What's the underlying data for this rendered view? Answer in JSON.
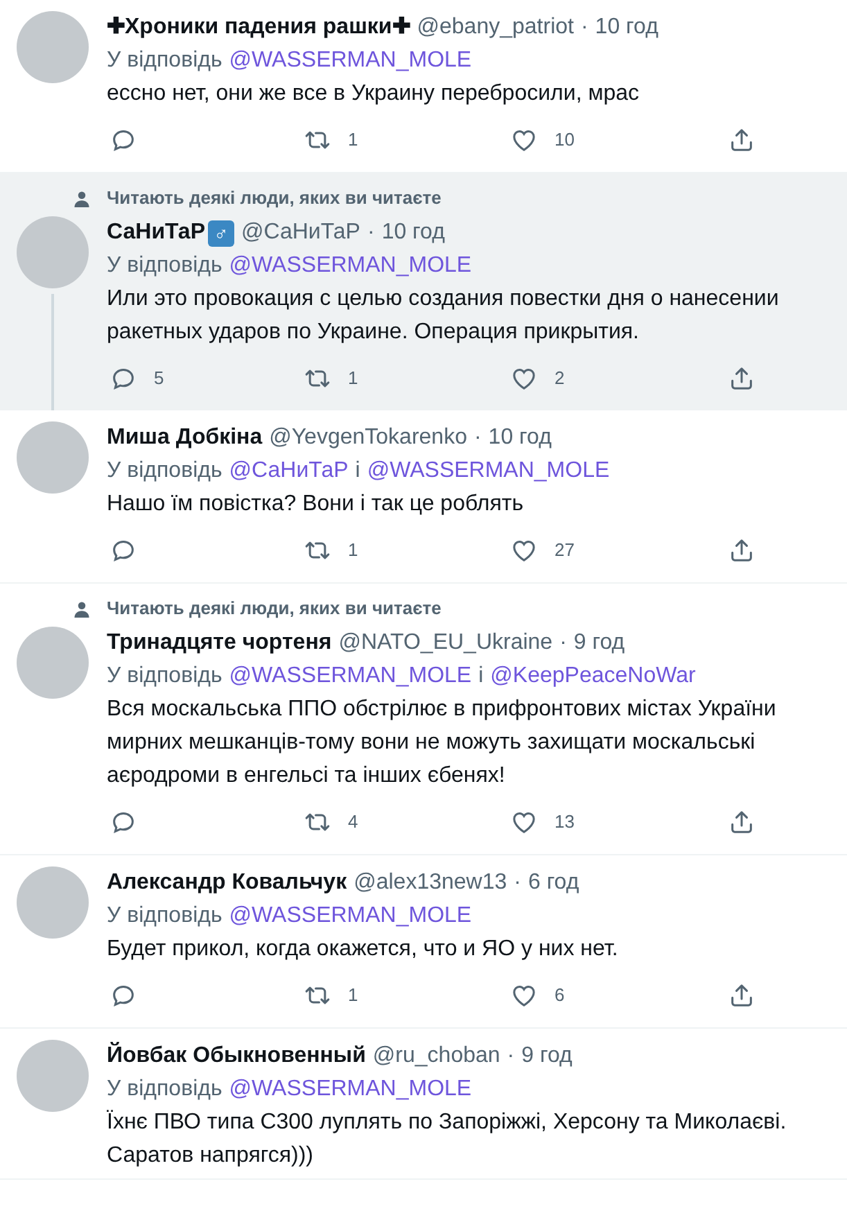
{
  "tweets": [
    {
      "name": "✚Хроники падения рашки✚",
      "handle": "@ebany_patriot",
      "separator": "·",
      "time": "10 год",
      "reply_to": [
        {
          "kind": "label",
          "text": "У відповідь"
        },
        {
          "kind": "mention",
          "text": "@WASSERMAN_MOLE"
        }
      ],
      "text": "ессно нет, они же все в Украину перебросили, мрас",
      "highlighted": false,
      "thread_below": false,
      "actions": {
        "retweets": "1",
        "likes": "10"
      }
    },
    {
      "social_context": "Читають деякі люди, яких ви читаєте",
      "name": "СаНиТаР",
      "badge": "♂",
      "handle": "@СаНиТаР",
      "separator": "·",
      "time": "10 год",
      "reply_to": [
        {
          "kind": "label",
          "text": "У відповідь"
        },
        {
          "kind": "mention",
          "text": "@WASSERMAN_MOLE"
        }
      ],
      "text": "Или это провокация с целью создания повестки дня о нанесении ракетных ударов по Украине. Операция прикрытия.",
      "highlighted": true,
      "thread_below": true,
      "actions": {
        "replies": "5",
        "retweets": "1",
        "likes": "2"
      }
    },
    {
      "name": "Миша Добкіна",
      "handle": "@YevgenTokarenko",
      "separator": "·",
      "time": "10 год",
      "reply_to": [
        {
          "kind": "label",
          "text": "У відповідь"
        },
        {
          "kind": "mention",
          "text": "@СаНиТаР"
        },
        {
          "kind": "word",
          "text": "і"
        },
        {
          "kind": "mention",
          "text": "@WASSERMAN_MOLE"
        }
      ],
      "text": "Нашо їм повістка? Вони і так це роблять",
      "highlighted": false,
      "thread_below": false,
      "actions": {
        "retweets": "1",
        "likes": "27"
      }
    },
    {
      "social_context": "Читають деякі люди, яких ви читаєте",
      "name": "Тринадцяте чортеня",
      "handle": "@NATO_EU_Ukraine",
      "separator": "·",
      "time": "9 год",
      "reply_to": [
        {
          "kind": "label",
          "text": "У відповідь"
        },
        {
          "kind": "mention",
          "text": "@WASSERMAN_MOLE"
        },
        {
          "kind": "word",
          "text": "і"
        },
        {
          "kind": "mention",
          "text": "@KeepPeaceNoWar"
        }
      ],
      "text": "Вся москальська ППО обстрілює в прифронтових містах України мирних мешканців-тому вони не можуть захищати москальські аєродроми в енгельсі та інших єбенях!",
      "highlighted": false,
      "thread_below": false,
      "actions": {
        "retweets": "4",
        "likes": "13"
      }
    },
    {
      "name": "Александр Ковальчук",
      "handle": "@alex13new13",
      "separator": "·",
      "time": "6 год",
      "reply_to": [
        {
          "kind": "label",
          "text": "У відповідь"
        },
        {
          "kind": "mention",
          "text": "@WASSERMAN_MOLE"
        }
      ],
      "text": "Будет прикол, когда окажется, что и ЯО у них нет.",
      "highlighted": false,
      "thread_below": false,
      "actions": {
        "retweets": "1",
        "likes": "6"
      }
    },
    {
      "name": "Йовбак Обыкновенный",
      "handle": "@ru_choban",
      "separator": "·",
      "time": "9 год",
      "reply_to": [
        {
          "kind": "label",
          "text": "У відповідь"
        },
        {
          "kind": "mention",
          "text": "@WASSERMAN_MOLE"
        }
      ],
      "text": "Їхнє ПВО типа С300 луплять по Запоріжжі, Херсону та Миколаєві. Саратов напрягся)))",
      "highlighted": false,
      "thread_below": false
    }
  ]
}
